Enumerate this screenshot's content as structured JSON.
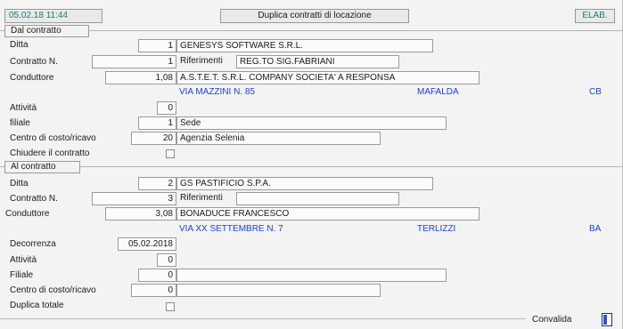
{
  "header": {
    "datetime": "05.02.18 11:44",
    "title": "Duplica contratti di locazione",
    "mode": "ELAB."
  },
  "from": {
    "section_label": "Dal contratto",
    "ditta_label": "Ditta",
    "ditta_code": "1",
    "ditta_name": "GENESYS SOFTWARE S.R.L.",
    "contratto_label": "Contratto N.",
    "contratto_value": "1",
    "riferimenti_label": "Riferimenti",
    "riferimenti_value": "REG.TO SIG.FABRIANI",
    "conduttore_label": "Conduttore",
    "conduttore_code": "1,08",
    "conduttore_name": "A.S.T.E.T. S.R.L. COMPANY SOCIETA' A RESPONSA",
    "address": "VIA MAZZINI N. 85",
    "city": "MAFALDA",
    "province": "CB",
    "attivita_label": "Attività",
    "attivita_value": "0",
    "filiale_label": "filiale",
    "filiale_code": "1",
    "filiale_name": "Sede",
    "centro_label": "Centro di costo/ricavo",
    "centro_code": "20",
    "centro_name": "Agenzia Selenia",
    "chiudere_label": "Chiudere il contratto"
  },
  "to": {
    "section_label": "Al contratto",
    "ditta_label": "Ditta",
    "ditta_code": "2",
    "ditta_name": "GS PASTIFICIO S.P.A.",
    "contratto_label": "Contratto N.",
    "contratto_value": "3",
    "riferimenti_label": "Riferimenti",
    "riferimenti_value": "",
    "conduttore_label": "Conduttore",
    "conduttore_code": "3,08",
    "conduttore_name": "BONADUCE FRANCESCO",
    "address": "VIA XX SETTEMBRE N. 7",
    "city": "TERLIZZI",
    "province": "BA",
    "decorrenza_label": "Decorrenza",
    "decorrenza_value": "05.02.2018",
    "attivita_label": "Attività",
    "attivita_value": "0",
    "filiale_label": "Filiale",
    "filiale_code": "0",
    "filiale_name": "",
    "centro_label": "Centro di costo/ricavo",
    "centro_code": "0",
    "centro_name": "",
    "duplica_label": "Duplica totale"
  },
  "footer": {
    "convalida_label": "Convalida"
  },
  "colors": {
    "address_blue": "#1f3fd0",
    "datetime_teal": "#1b7a78"
  }
}
